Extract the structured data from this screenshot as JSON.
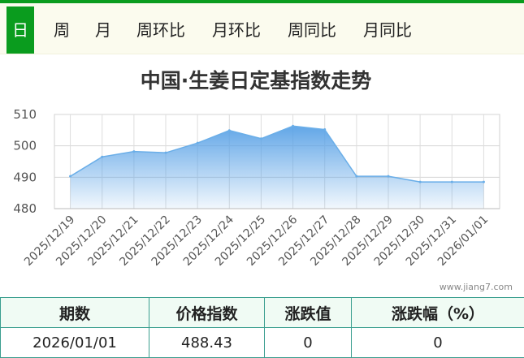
{
  "tabs": [
    {
      "label": "日",
      "active": true
    },
    {
      "label": "周",
      "active": false
    },
    {
      "label": "月",
      "active": false
    },
    {
      "label": "周环比",
      "active": false
    },
    {
      "label": "月环比",
      "active": false
    },
    {
      "label": "周同比",
      "active": false
    },
    {
      "label": "月同比",
      "active": false
    }
  ],
  "watermark": "www.jiang7.com",
  "colors": {
    "accent": "#0a9c1e",
    "area_top": "#5aa2e6",
    "area_line": "#6aaee8",
    "table_border": "#3a9e8f"
  },
  "chart_data": {
    "type": "area",
    "title": "中国·生姜日定基指数走势",
    "xlabel": "",
    "ylabel": "",
    "categories": [
      "2025/12/19",
      "2025/12/20",
      "2025/12/21",
      "2025/12/22",
      "2025/12/23",
      "2025/12/24",
      "2025/12/25",
      "2025/12/26",
      "2025/12/27",
      "2025/12/28",
      "2025/12/29",
      "2025/12/30",
      "2025/12/31",
      "2026/01/01"
    ],
    "series": [
      {
        "values": [
          490.3,
          496.5,
          498.2,
          497.8,
          500.9,
          504.9,
          502.3,
          506.3,
          505.2,
          490.3,
          490.3,
          488.5,
          488.5,
          488.5
        ]
      }
    ],
    "ylim": [
      480,
      510
    ],
    "yticks": [
      "480",
      "490",
      "500",
      "510"
    ],
    "grid": true,
    "legend": "none"
  },
  "summary": {
    "headers": [
      "期数",
      "价格指数",
      "涨跌值",
      "涨跌幅（%）"
    ],
    "row": [
      "2026/01/01",
      "488.43",
      "0",
      "0"
    ]
  }
}
